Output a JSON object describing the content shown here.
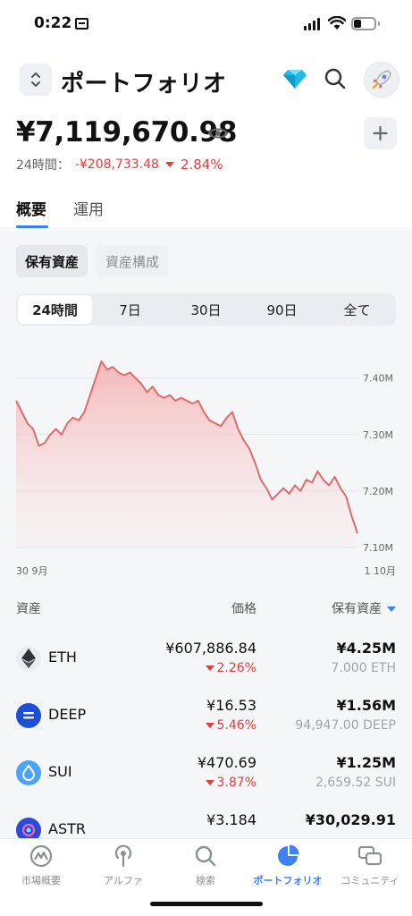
{
  "status_bar": {
    "time": "0:22",
    "battery_level": 0.35
  },
  "header": {
    "title": "ポートフォリオ"
  },
  "summary": {
    "balance": "¥7,119,670.98",
    "change_label": "24時間：",
    "change_value": "-¥208,733.48",
    "change_pct": "2.84%"
  },
  "tabs": [
    {
      "label": "概要",
      "active": true
    },
    {
      "label": "運用",
      "active": false
    }
  ],
  "pills": [
    {
      "label": "保有資産",
      "active": true
    },
    {
      "label": "資産構成",
      "active": false
    }
  ],
  "ranges": [
    "24時間",
    "7日",
    "30日",
    "90日",
    "全て"
  ],
  "active_range": "24時間",
  "chart_data": {
    "type": "area",
    "color": "#e06060",
    "fill": "#f7c6c6",
    "x_labels": [
      "30 9月",
      "1 10月"
    ],
    "y_ticks": [
      "7.40M",
      "7.30M",
      "7.20M",
      "7.10M"
    ],
    "y_tick_values": [
      7.4,
      7.3,
      7.2,
      7.1
    ],
    "ylim": [
      7.1,
      7.455
    ],
    "unit": "M",
    "values": [
      7.36,
      7.34,
      7.32,
      7.31,
      7.28,
      7.285,
      7.3,
      7.31,
      7.3,
      7.32,
      7.33,
      7.325,
      7.34,
      7.37,
      7.4,
      7.43,
      7.415,
      7.42,
      7.41,
      7.405,
      7.41,
      7.4,
      7.39,
      7.375,
      7.385,
      7.37,
      7.365,
      7.37,
      7.36,
      7.365,
      7.36,
      7.355,
      7.36,
      7.34,
      7.325,
      7.32,
      7.315,
      7.33,
      7.34,
      7.31,
      7.29,
      7.275,
      7.25,
      7.22,
      7.205,
      7.185,
      7.195,
      7.205,
      7.195,
      7.21,
      7.2,
      7.22,
      7.215,
      7.235,
      7.22,
      7.21,
      7.225,
      7.205,
      7.19,
      7.155,
      7.125
    ]
  },
  "table": {
    "col_asset": "資産",
    "col_price": "価格",
    "col_holding": "保有資産"
  },
  "assets": [
    {
      "name": "ETH",
      "price": "¥607,886.84",
      "pct": "2.26%",
      "holding": "¥4.25M",
      "qty": "7.000 ETH",
      "icon": "eth-icon",
      "color": "#ecedf0"
    },
    {
      "name": "DEEP",
      "price": "¥16.53",
      "pct": "5.46%",
      "holding": "¥1.56M",
      "qty": "94,947.00 DEEP",
      "icon": "deep-icon",
      "color": "#1d4ed8"
    },
    {
      "name": "SUI",
      "price": "¥470.69",
      "pct": "3.87%",
      "holding": "¥1.25M",
      "qty": "2,659.52 SUI",
      "icon": "sui-icon",
      "color": "#4da2ff"
    },
    {
      "name": "ASTR",
      "price": "¥3.184",
      "pct": "",
      "holding": "¥30,029.91",
      "qty": "",
      "icon": "astr-icon",
      "color": "#2a4bd7"
    }
  ],
  "nav": [
    {
      "label": "市場概要",
      "icon": "market-icon",
      "active": false
    },
    {
      "label": "アルファ",
      "icon": "alpha-icon",
      "active": false
    },
    {
      "label": "検索",
      "icon": "search-icon",
      "active": false
    },
    {
      "label": "ポートフォリオ",
      "icon": "portfolio-icon",
      "active": true
    },
    {
      "label": "コミュニティ",
      "icon": "community-icon",
      "active": false
    }
  ]
}
